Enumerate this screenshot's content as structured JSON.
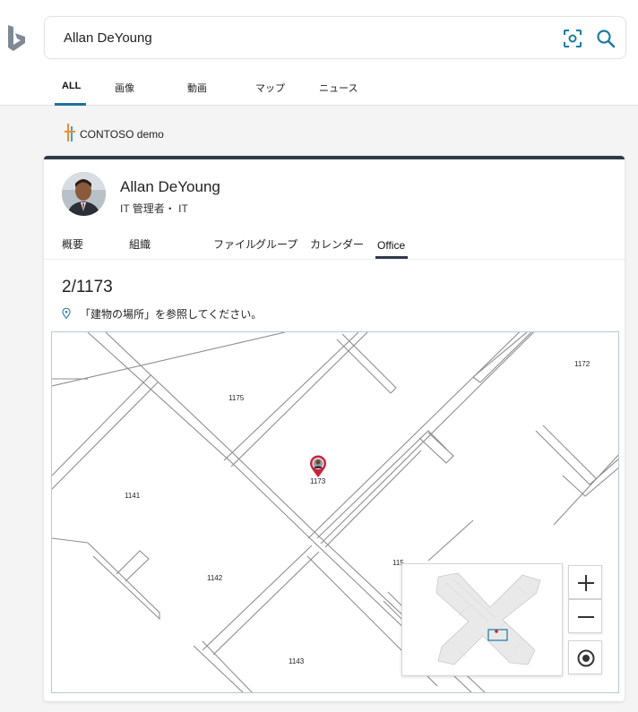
{
  "search": {
    "query": "Allan DeYoung"
  },
  "tabs": [
    {
      "label": "ALL",
      "active": true
    },
    {
      "label": "画像"
    },
    {
      "label": "動画"
    },
    {
      "label": "マップ"
    },
    {
      "label": "ニュース"
    }
  ],
  "brand": {
    "name": "CONTOSO demo"
  },
  "person": {
    "name": "Allan DeYoung",
    "role": "IT 管理者・ IT"
  },
  "profile_tabs": [
    {
      "label": "概要"
    },
    {
      "label": "組織"
    },
    {
      "label": "ファイル"
    },
    {
      "label": "グループ"
    },
    {
      "label": "カレンダー"
    },
    {
      "label": "Office",
      "active": true
    }
  ],
  "office": {
    "room": "2/1173",
    "hint": "「建物の場所」を参照してください。",
    "rooms": [
      "1172",
      "1175",
      "1173",
      "1141",
      "1142",
      "1143",
      "115"
    ]
  },
  "map_controls": {
    "zoom_in": "+",
    "zoom_out": "−"
  },
  "colors": {
    "accent": "#1f6f9f",
    "card_border": "#2f3a48",
    "icon": "#2a7ea8",
    "pin": "#c8233a"
  }
}
